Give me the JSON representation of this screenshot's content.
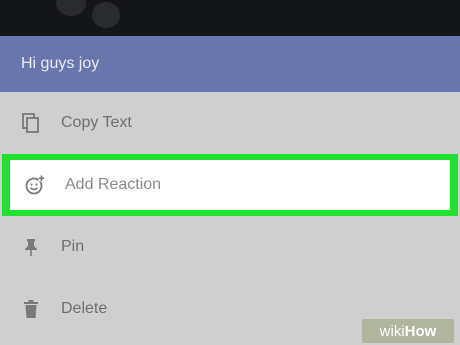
{
  "header": {
    "title": "Hi guys joy"
  },
  "menu": {
    "items": [
      {
        "label": "Copy Text",
        "icon": "copy-icon"
      },
      {
        "label": "Add Reaction",
        "icon": "add-reaction-icon",
        "highlighted": true
      },
      {
        "label": "Pin",
        "icon": "pin-icon"
      },
      {
        "label": "Delete",
        "icon": "trash-icon"
      }
    ]
  },
  "watermark": {
    "wiki": "wiki",
    "how": "How"
  },
  "colors": {
    "header": "#6a75ad",
    "sheet": "#cfcfcf",
    "highlight_border": "#21e12f",
    "top_strip": "#151618"
  }
}
